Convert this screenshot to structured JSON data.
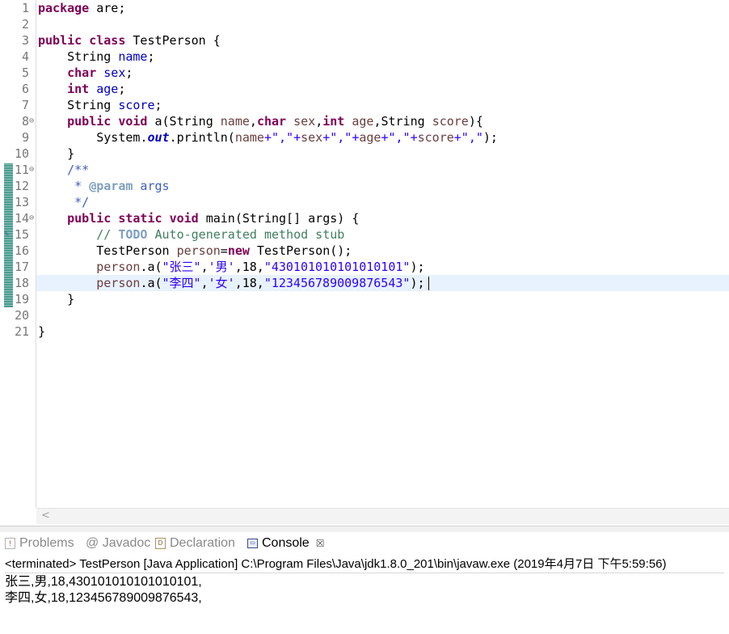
{
  "editor": {
    "line_numbers": [
      "1",
      "2",
      "3",
      "4",
      "5",
      "6",
      "7",
      "8",
      "9",
      "10",
      "11",
      "12",
      "13",
      "14",
      "15",
      "16",
      "17",
      "18",
      "19",
      "20",
      "21"
    ],
    "lines": {
      "l1_kw": "package",
      "l1_rest": " are;",
      "l3_kw1": "public",
      "l3_kw2": "class",
      "l3_rest": " TestPerson {",
      "l4_type": "    String ",
      "l4_field": "name",
      "l4_end": ";",
      "l5_kw": "char",
      "l5_field": "sex",
      "l5_end": ";",
      "l6_kw": "int",
      "l6_field": "age",
      "l6_end": ";",
      "l7_type": "    String ",
      "l7_field": "score",
      "l7_end": ";",
      "l8_kw1": "public",
      "l8_kw2": "void",
      "l8_a": " a(String ",
      "l8_p1": "name",
      "l8_c1": ",",
      "l8_kw3": "char",
      "l8_p2": " sex",
      "l8_c2": ",",
      "l8_kw4": "int",
      "l8_p3": " age",
      "l8_c3": ",String ",
      "l8_p4": "score",
      "l8_end": "){",
      "l9_a": "        System.",
      "l9_out": "out",
      "l9_b": ".println(",
      "l9_p1": "name",
      "l9_s1": "+\",\"+",
      "l9_p2": "sex",
      "l9_s2": "+\",\"+",
      "l9_p3": "age",
      "l9_s3": "+\",\"+",
      "l9_p4": "score",
      "l9_s4": "+\",\"",
      "l9_end": ");",
      "l10": "    }",
      "l11": "    /**",
      "l12_a": "     * ",
      "l12_tag": "@param",
      "l12_b": " args",
      "l13": "     */",
      "l14_kw1": "public",
      "l14_kw2": "static",
      "l14_kw3": "void",
      "l14_rest": " main(String[] args) {",
      "l15_a": "        // ",
      "l15_todo": "TODO",
      "l15_b": " Auto-generated method stub",
      "l16_a": "        TestPerson ",
      "l16_var": "person",
      "l16_eq": "=",
      "l16_kw": "new",
      "l16_rest": " TestPerson();",
      "l17_a": "        person",
      "l17_b": ".a(",
      "l17_s1": "\"张三\"",
      "l17_c1": ",",
      "l17_s2": "'男'",
      "l17_c2": ",18,",
      "l17_s3": "\"430101010101010101\"",
      "l17_end": ");",
      "l18_a": "        person",
      "l18_b": ".a(",
      "l18_s1": "\"李四\"",
      "l18_c1": ",",
      "l18_s2": "'女'",
      "l18_c2": ",18,",
      "l18_s3": "\"123456789009876543\"",
      "l18_end": ");",
      "l19": "    }",
      "l21": "}"
    },
    "scroll_left": "<"
  },
  "tabs": [
    {
      "label": "Problems",
      "icon": "problems-icon"
    },
    {
      "label": "@ Javadoc",
      "icon": "javadoc-icon"
    },
    {
      "label": "Declaration",
      "icon": "declaration-icon"
    },
    {
      "label": "Console",
      "icon": "console-icon",
      "close": "☒"
    }
  ],
  "console": {
    "status": "<terminated> TestPerson [Java Application] C:\\Program Files\\Java\\jdk1.8.0_201\\bin\\javaw.exe (2019年4月7日 下午5:59:56)",
    "output": [
      "张三,男,18,430101010101010101,",
      "李四,女,18,123456789009876543,"
    ]
  },
  "colors": {
    "keyword": "#7f0055",
    "field": "#0000c0",
    "string": "#2a00ff",
    "comment": "#3f7f5f",
    "javadoc": "#3f5fbf",
    "current_line": "#e8f2fe",
    "change_bar": "#4b9d8f"
  }
}
